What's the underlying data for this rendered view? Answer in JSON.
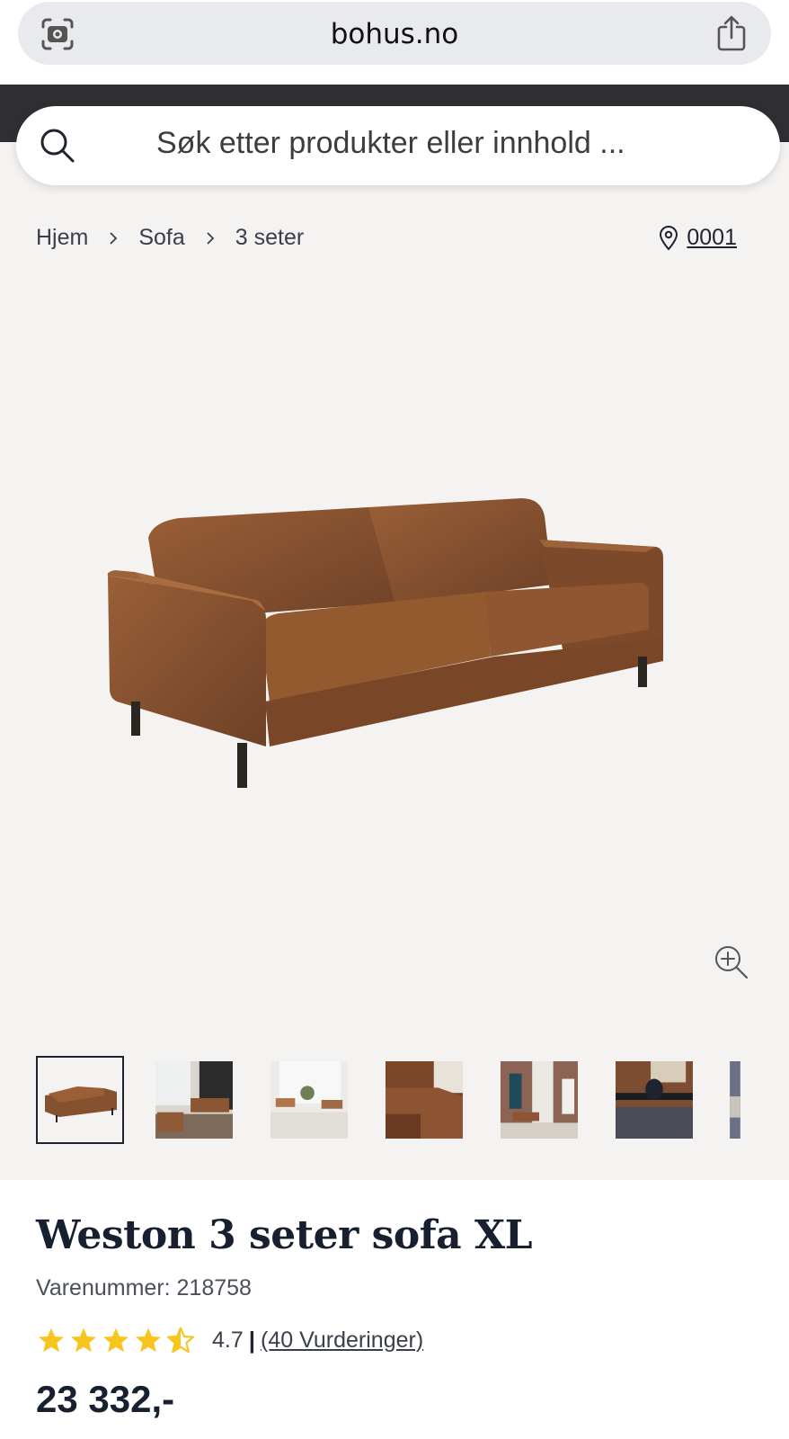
{
  "browser": {
    "url": "bohus.no",
    "lens_icon": "camera-lens-icon",
    "share_icon": "share-icon"
  },
  "search": {
    "placeholder": "Søk etter produkter eller innhold ...",
    "icon": "search-icon"
  },
  "breadcrumb": {
    "items": [
      "Hjem",
      "Sofa",
      "3 seter"
    ],
    "separator_icon": "chevron-right-icon"
  },
  "store": {
    "label": "0001",
    "icon": "location-pin-icon"
  },
  "gallery": {
    "main_image": "brown leather 3-seater sofa",
    "zoom_icon": "zoom-in-icon",
    "thumbnails": [
      "sofa product photo",
      "living room scene",
      "bright living room scene",
      "armrest close-up",
      "room with fireplace",
      "sofa with coffee table",
      "partial photo"
    ],
    "selected_thumbnail": 0
  },
  "product": {
    "title": "Weston 3 seter sofa XL",
    "sku": "Varenummer: 218758",
    "rating_value": "4.7",
    "rating_separator": "|",
    "rating_count": "(40 Vurderinger)",
    "stars": 4.7,
    "price": "23 332,-"
  },
  "colors": {
    "star": "#f7c51d",
    "dark_band": "#2f2f33",
    "text": "#17202f",
    "sofa_leather": "#8a5331"
  }
}
